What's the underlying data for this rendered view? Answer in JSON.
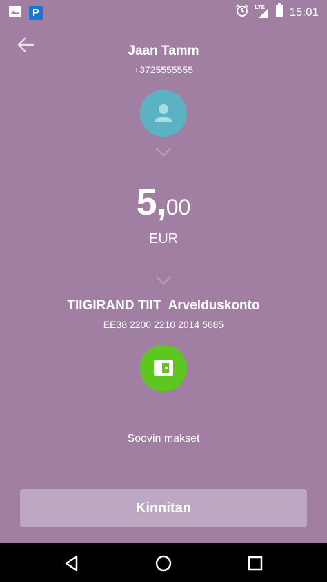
{
  "status_bar": {
    "parking_badge": "P",
    "network": "LTE",
    "time": "15:01",
    "icons": [
      "image-icon",
      "parking-icon",
      "alarm-icon",
      "signal-icon",
      "battery-icon"
    ]
  },
  "recipient": {
    "name": "Jaan Tamm",
    "phone": "+3725555555"
  },
  "payment": {
    "amount_whole": "5,",
    "amount_decimal": "00",
    "currency": "EUR"
  },
  "account": {
    "owner": "TIIGIRAND TIIT",
    "type": "Arvelduskonto",
    "iban": "EE38 2200 2210 2014 5685"
  },
  "description": "Soovin makset",
  "confirm_label": "Kinnitan",
  "colors": {
    "background": "#a07fa3",
    "avatar": "#5bb2c1",
    "wallet": "#5ec71f",
    "button": "#bea7c2"
  }
}
